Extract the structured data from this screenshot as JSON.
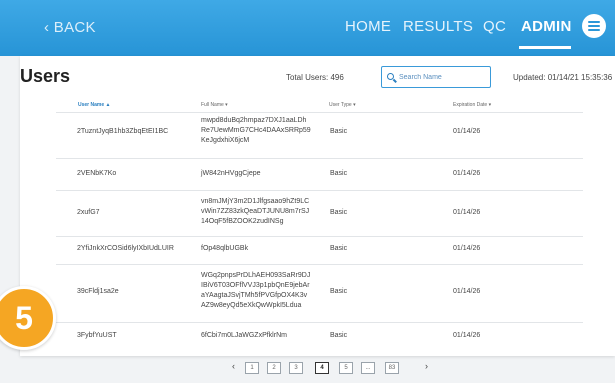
{
  "nav": {
    "back_label": "‹ BACK",
    "items": [
      {
        "label": "HOME"
      },
      {
        "label": "RESULTS"
      },
      {
        "label": "QC"
      },
      {
        "label": "ADMIN"
      }
    ],
    "menu_icon": "hamburger-icon"
  },
  "header": {
    "title": "Users",
    "total": "Total Users: 496",
    "search_placeholder": "Search Name",
    "updated": "Updated: 01/14/21 15:35:36"
  },
  "table": {
    "columns": [
      "User Name ▲",
      "Full Name ▾",
      "User Type ▾",
      "Expiration Date ▾"
    ],
    "rows": [
      {
        "user": "2TuzntJyqB1hb3ZbqEtEI1BC",
        "full": [
          "mwpd8duBq2hmpaz7DXJ1aaLDh",
          "Re7UewMmG7CHc4DAAxSRRp59",
          "KeJgdxhiX6jcM"
        ],
        "type": "Basic",
        "exp": "01/14/26"
      },
      {
        "user": "2VENbK7Ko",
        "full": [
          "jW842nHVggCjepe"
        ],
        "type": "Basic",
        "exp": "01/14/26"
      },
      {
        "user": "2xufG7",
        "full": [
          "vn8mJMjY3m2D1Jlfgsaao9hZt9LC",
          "vWin7ZZ83zkQeaDTJUNU8m7rSJ",
          "14OqF5fBZOOK2zudINSg"
        ],
        "type": "Basic",
        "exp": "01/14/26"
      },
      {
        "user": "2YfiJnkXrCOSid6lyIXbIUdLUIR",
        "full": [
          "fOp48qlbUGBk"
        ],
        "type": "Basic",
        "exp": "01/14/26"
      },
      {
        "user": "39cFldj1sa2e",
        "full": [
          "WGq2pnpsPrDLhAEH093SaRr9DJ",
          "IBiV6T03OFflVVJ3p1pbQnE9jebAr",
          "aYAagtaJSvjTMh5fPVGfpOX4K3v",
          "AZ9w8eyQd5eXkQwWpkI5Ldua"
        ],
        "type": "Basic",
        "exp": "01/14/26"
      },
      {
        "user": "3FybfYuUST",
        "full": [
          "6fCbi7m0LJaWGZxPfklrNm"
        ],
        "type": "Basic",
        "exp": "01/14/26"
      }
    ]
  },
  "step_badge": "5",
  "pagination": {
    "prev": "‹",
    "next": "›",
    "pages": [
      "1",
      "2",
      "3",
      "4",
      "5",
      "...",
      "83"
    ],
    "active": "4"
  },
  "colors": {
    "accent": "#2794d6",
    "badge": "#f5a623"
  }
}
